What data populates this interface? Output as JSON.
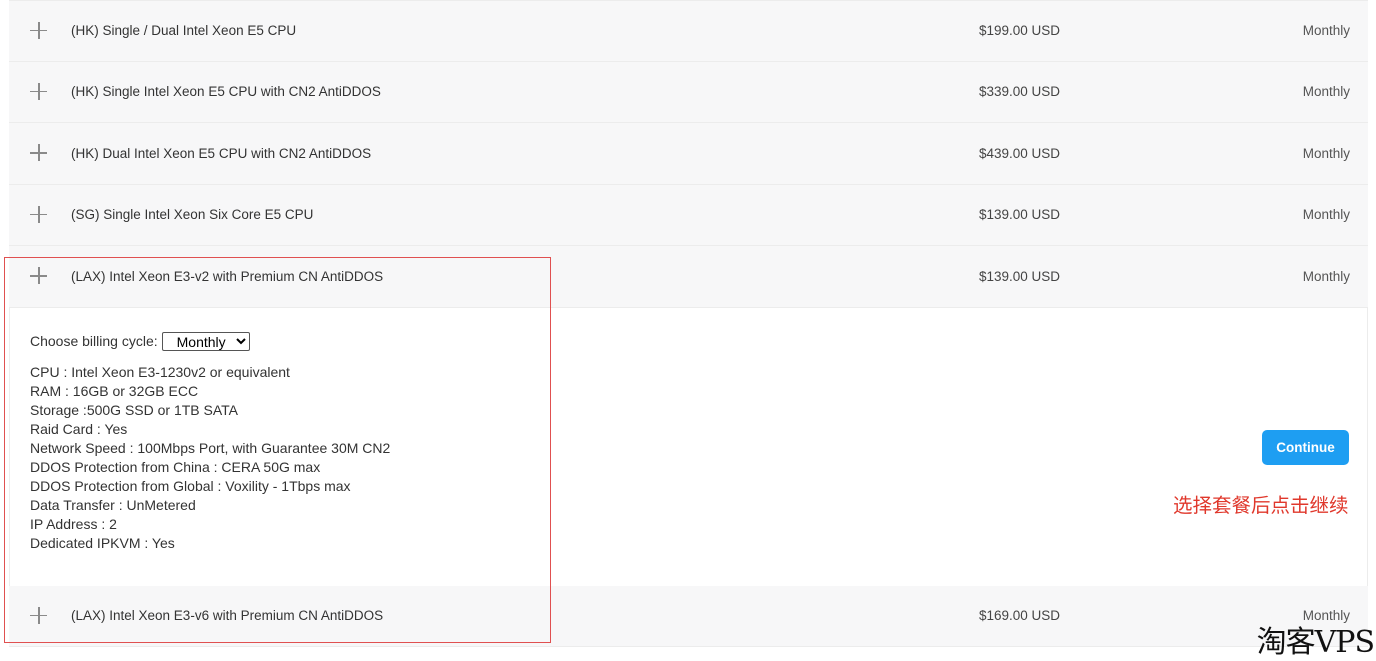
{
  "products": [
    {
      "name": "(HK) Single / Dual Intel Xeon E5 CPU",
      "price": "$199.00 USD",
      "cycle": "Monthly"
    },
    {
      "name": "(HK) Single Intel Xeon E5 CPU with CN2 AntiDDOS",
      "price": "$339.00 USD",
      "cycle": "Monthly"
    },
    {
      "name": "(HK) Dual Intel Xeon E5 CPU with CN2 AntiDDOS",
      "price": "$439.00 USD",
      "cycle": "Monthly"
    },
    {
      "name": "(SG) Single Intel Xeon Six Core E5 CPU",
      "price": "$139.00 USD",
      "cycle": "Monthly"
    },
    {
      "name": "(LAX) Intel Xeon E3-v2 with Premium CN AntiDDOS",
      "price": "$139.00 USD",
      "cycle": "Monthly"
    },
    {
      "name": "(LAX) Intel Xeon E3-v6 with Premium CN AntiDDOS",
      "price": "$169.00 USD",
      "cycle": "Monthly"
    }
  ],
  "expanded": {
    "billing_label": "Choose billing cycle:",
    "billing_selected": "Monthly",
    "specs": [
      "CPU  : Intel Xeon E3-1230v2 or equivalent",
      "RAM : 16GB or 32GB ECC",
      "Storage :500G SSD or 1TB SATA",
      "Raid Card : Yes",
      "Network Speed : 100Mbps Port, with Guarantee 30M CN2",
      "DDOS Protection from China : CERA 50G max",
      "DDOS Protection from Global : Voxility - 1Tbps max",
      "Data Transfer : UnMetered",
      "IP Address : 2",
      "Dedicated IPKVM : Yes"
    ],
    "continue_label": "Continue"
  },
  "annotation": {
    "note": "选择套餐后点击继续",
    "color": "#e0382c"
  },
  "watermark": "淘客VPS",
  "colors": {
    "accent": "#1e9ef2",
    "highlight_border": "#e05050"
  }
}
